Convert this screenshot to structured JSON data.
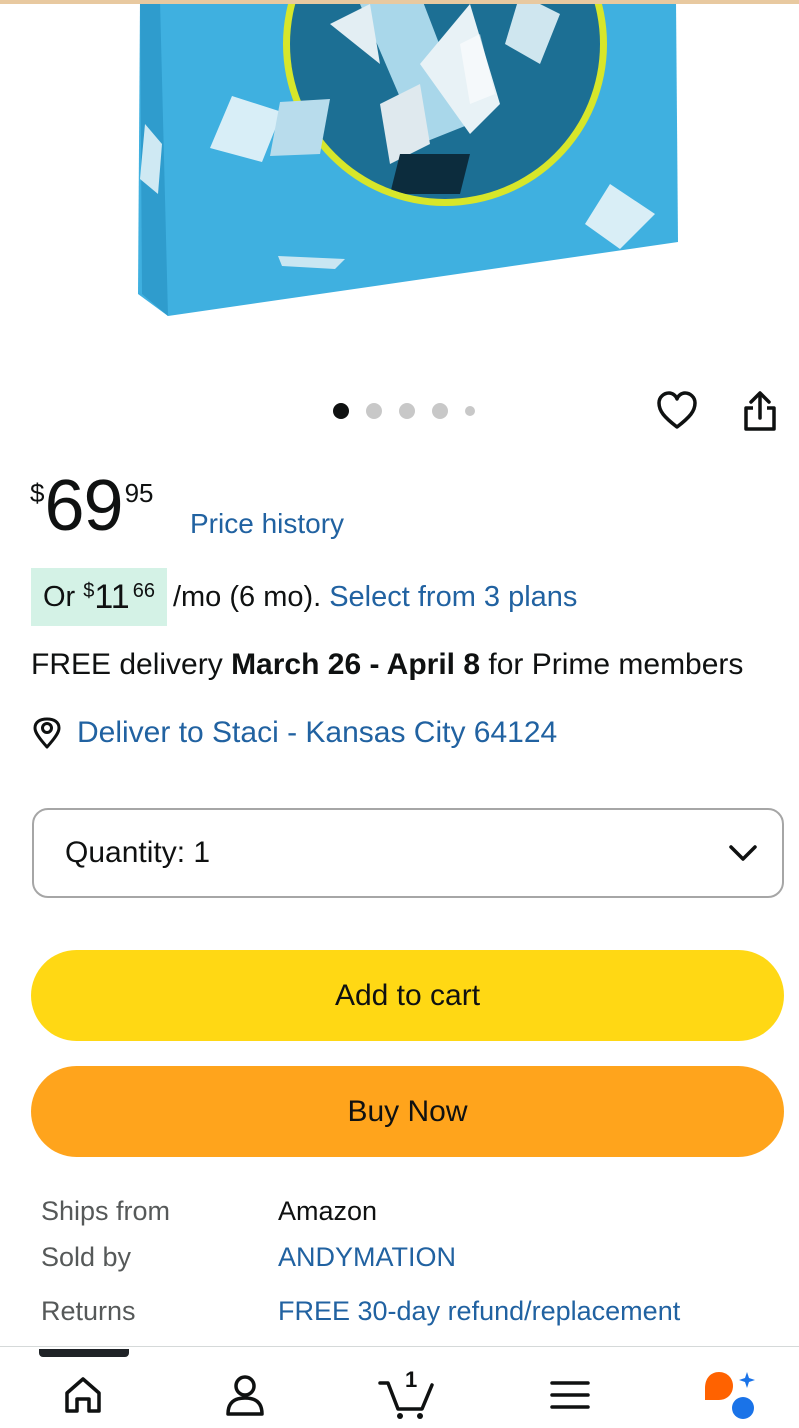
{
  "carousel": {
    "total_images": 5,
    "active_index": 0
  },
  "actions": {
    "wishlist_icon": "heart-icon",
    "share_icon": "share-icon"
  },
  "price": {
    "symbol": "$",
    "whole": "69",
    "fraction": "95",
    "history_link": "Price history"
  },
  "installment": {
    "prefix": "Or",
    "symbol": "$",
    "whole": "11",
    "fraction": "66",
    "term": "/mo (6 mo).",
    "plans_link": "Select from 3 plans"
  },
  "delivery": {
    "prefix": "FREE delivery",
    "dates": "March 26 - April 8",
    "suffix": "for Prime members"
  },
  "location": {
    "icon": "location-pin-icon",
    "text": "Deliver to Staci - Kansas City 64124"
  },
  "quantity": {
    "label": "Quantity:",
    "value": "1"
  },
  "buttons": {
    "add_to_cart": "Add to cart",
    "buy_now": "Buy Now"
  },
  "details": [
    {
      "key": "Ships from",
      "value": "Amazon",
      "link": false
    },
    {
      "key": "Sold by",
      "value": "ANDYMATION",
      "link": true
    },
    {
      "key": "Returns",
      "value": "FREE 30-day refund/replacement",
      "link": true
    }
  ],
  "nav": {
    "items": [
      "home-icon",
      "account-icon",
      "cart-icon",
      "menu-icon",
      "assistant-icon"
    ],
    "cart_count": "1"
  },
  "colors": {
    "link": "#2162a1",
    "add_to_cart": "#ffd814",
    "buy_now": "#ffa41c",
    "installment_badge": "#d4f2e6",
    "product_box": "#3fb0e0"
  }
}
